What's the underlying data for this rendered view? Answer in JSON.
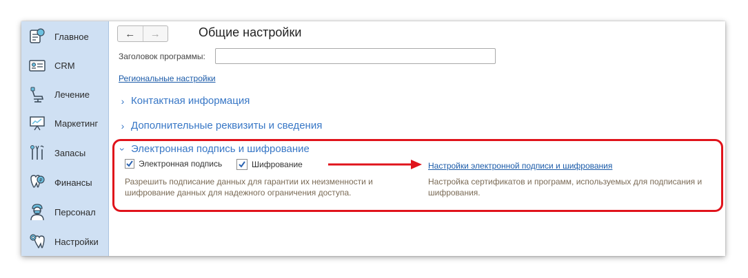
{
  "sidebar": {
    "items": [
      {
        "label": "Главное",
        "icon": "home-doc-icon"
      },
      {
        "label": "CRM",
        "icon": "id-card-icon"
      },
      {
        "label": "Лечение",
        "icon": "dental-chair-icon"
      },
      {
        "label": "Маркетинг",
        "icon": "presentation-board-icon"
      },
      {
        "label": "Запасы",
        "icon": "dental-tools-icon"
      },
      {
        "label": "Финансы",
        "icon": "tooth-coin-icon"
      },
      {
        "label": "Персонал",
        "icon": "doctor-icon"
      },
      {
        "label": "Настройки",
        "icon": "tooth-gear-icon"
      }
    ]
  },
  "nav": {
    "back": "←",
    "forward": "→"
  },
  "page": {
    "title": "Общие настройки",
    "program_title_label": "Заголовок программы:",
    "program_title_value": "",
    "regional_link": "Региональные настройки"
  },
  "sections": {
    "contact": "Контактная информация",
    "additional": "Дополнительные реквизиты и сведения",
    "signature": "Электронная подпись и шифрование"
  },
  "signature": {
    "sign_label": "Электронная подпись",
    "sign_checked": true,
    "encrypt_label": "Шифрование",
    "encrypt_checked": true,
    "left_desc_1": "Разрешить подписание данных для гарантии их неизменности и",
    "left_desc_2": "шифрование данных для надежного ограничения доступа.",
    "settings_link": "Настройки электронной подписи и шифрования",
    "right_desc_1": "Настройка сертификатов и программ, используемых для подписания и",
    "right_desc_2": "шифрования."
  },
  "colors": {
    "sidebar_bg": "#cfe0f3",
    "section_header": "#3877c6",
    "link": "#1a5aa8",
    "highlight_red": "#e0131b",
    "description": "#7a6a55"
  }
}
